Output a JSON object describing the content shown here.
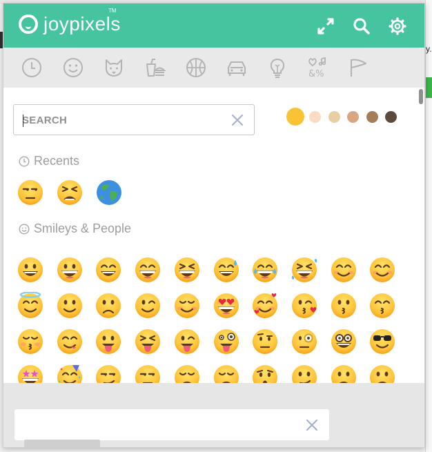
{
  "header": {
    "logo_text": "joypixels",
    "logo_tm": "TM",
    "icons": [
      "expand-icon",
      "search-icon",
      "gear-icon"
    ]
  },
  "categories": [
    "recent-clock-icon",
    "smiley-icon",
    "animal-icon",
    "food-icon",
    "sports-ball-icon",
    "car-icon",
    "lightbulb-icon",
    "symbols-icon",
    "flag-icon"
  ],
  "search": {
    "placeholder": "SEARCH",
    "value": ""
  },
  "skin_tones": [
    "#f8c335",
    "#f9dcc1",
    "#e8cfa3",
    "#d9a582",
    "#a57d56",
    "#5c4a3d"
  ],
  "sections": {
    "recents_label": "Recents",
    "smileys_label": "Smileys & People"
  },
  "recents": [
    "unamused-face",
    "tired-face",
    "globe-asia-australia"
  ],
  "smileys": [
    "grinning-face",
    "grinning-face-big-eyes",
    "grinning-face-smiling-eyes",
    "beaming-face",
    "grinning-squinting-face",
    "grinning-face-sweat",
    "face-tears-of-joy",
    "rolling-laughing",
    "smiling-face",
    "smiling-face-smiling-eyes",
    "smiling-face-halo",
    "slightly-smiling-face",
    "upside-down-face",
    "winking-face",
    "relieved-face",
    "smiling-face-heart-eyes",
    "smiling-face-hearts",
    "face-blowing-kiss",
    "kissing-face",
    "kissing-face-smiling-eyes",
    "kissing-face-closed-eyes",
    "face-savoring-food",
    "face-with-tongue",
    "squinting-face-tongue",
    "winking-face-tongue",
    "zany-face",
    "face-raised-eyebrow",
    "face-with-monocle",
    "nerd-face",
    "smiling-face-sunglasses",
    "star-struck",
    "partying-face",
    "smirking-face",
    "unamused-face",
    "disappointed-face",
    "pensive-face",
    "worried-face",
    "confused-face",
    "slightly-frowning-face",
    "frowning-face"
  ],
  "footer": {
    "input_value": ""
  },
  "background": {
    "right_text": "y."
  }
}
